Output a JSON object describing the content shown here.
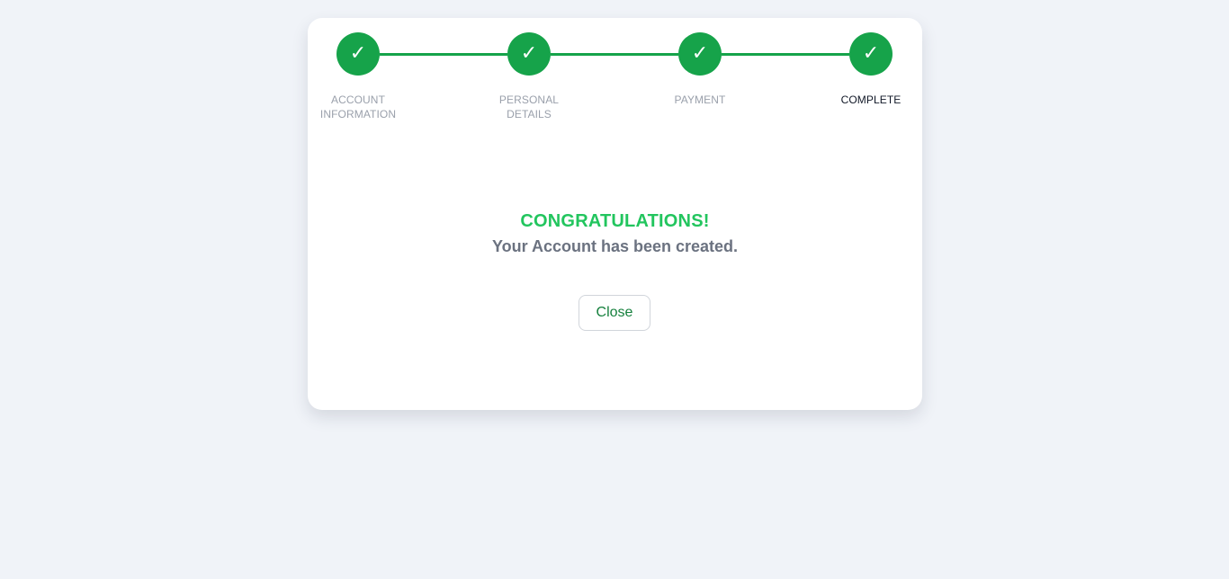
{
  "stepper": {
    "steps": [
      {
        "label": "ACCOUNT INFORMATION",
        "status": "completed",
        "icon": "checkmark-icon",
        "glyph": "✓"
      },
      {
        "label": "PERSONAL DETAILS",
        "status": "completed",
        "icon": "checkmark-icon",
        "glyph": "✓"
      },
      {
        "label": "PAYMENT",
        "status": "completed",
        "icon": "checkmark-icon",
        "glyph": "✓"
      },
      {
        "label": "COMPLETE",
        "status": "current",
        "icon": "checkmark-icon",
        "glyph": "✓"
      }
    ]
  },
  "message": {
    "heading": "CONGRATULATIONS!",
    "subtitle": "Your Account has been created."
  },
  "actions": {
    "close_label": "Close"
  },
  "colors": {
    "accent": "#16a34a",
    "heading": "#22c55e",
    "background": "#f0f3f8"
  }
}
